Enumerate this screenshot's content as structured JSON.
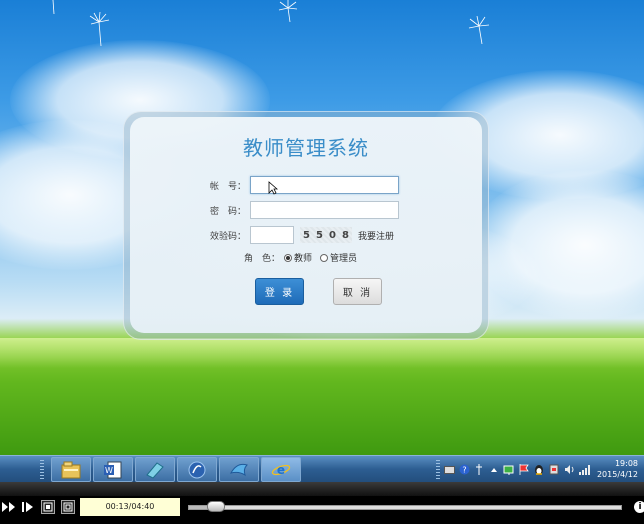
{
  "login": {
    "title": "教师管理系统",
    "account_label": "帐　号：",
    "account_value": "",
    "password_label": "密　码：",
    "password_value": "",
    "captcha_label": "效验码：",
    "captcha_value": "",
    "captcha_digits": [
      "5",
      "5",
      "0",
      "8"
    ],
    "register_link": "我要注册",
    "role_label": "角　色：",
    "roles": [
      {
        "label": "教师",
        "checked": true
      },
      {
        "label": "管理员",
        "checked": false
      }
    ],
    "login_button": "登 录",
    "cancel_button": "取 消"
  },
  "taskbar": {
    "apps": [
      {
        "icon": "file-explorer-icon"
      },
      {
        "icon": "word-document-icon"
      },
      {
        "icon": "notebook-app-icon"
      },
      {
        "icon": "media-player-icon"
      },
      {
        "icon": "dolphin-app-icon"
      },
      {
        "icon": "internet-explorer-icon",
        "active": true
      }
    ],
    "clock_time": "19:08",
    "clock_date": "2015/4/12"
  },
  "player": {
    "time": "00:13/04:40",
    "progress": 0.046
  },
  "colors": {
    "title": "#3a8dc8",
    "login_button": "#1e6bb8",
    "taskbar": "#2d5e92"
  }
}
